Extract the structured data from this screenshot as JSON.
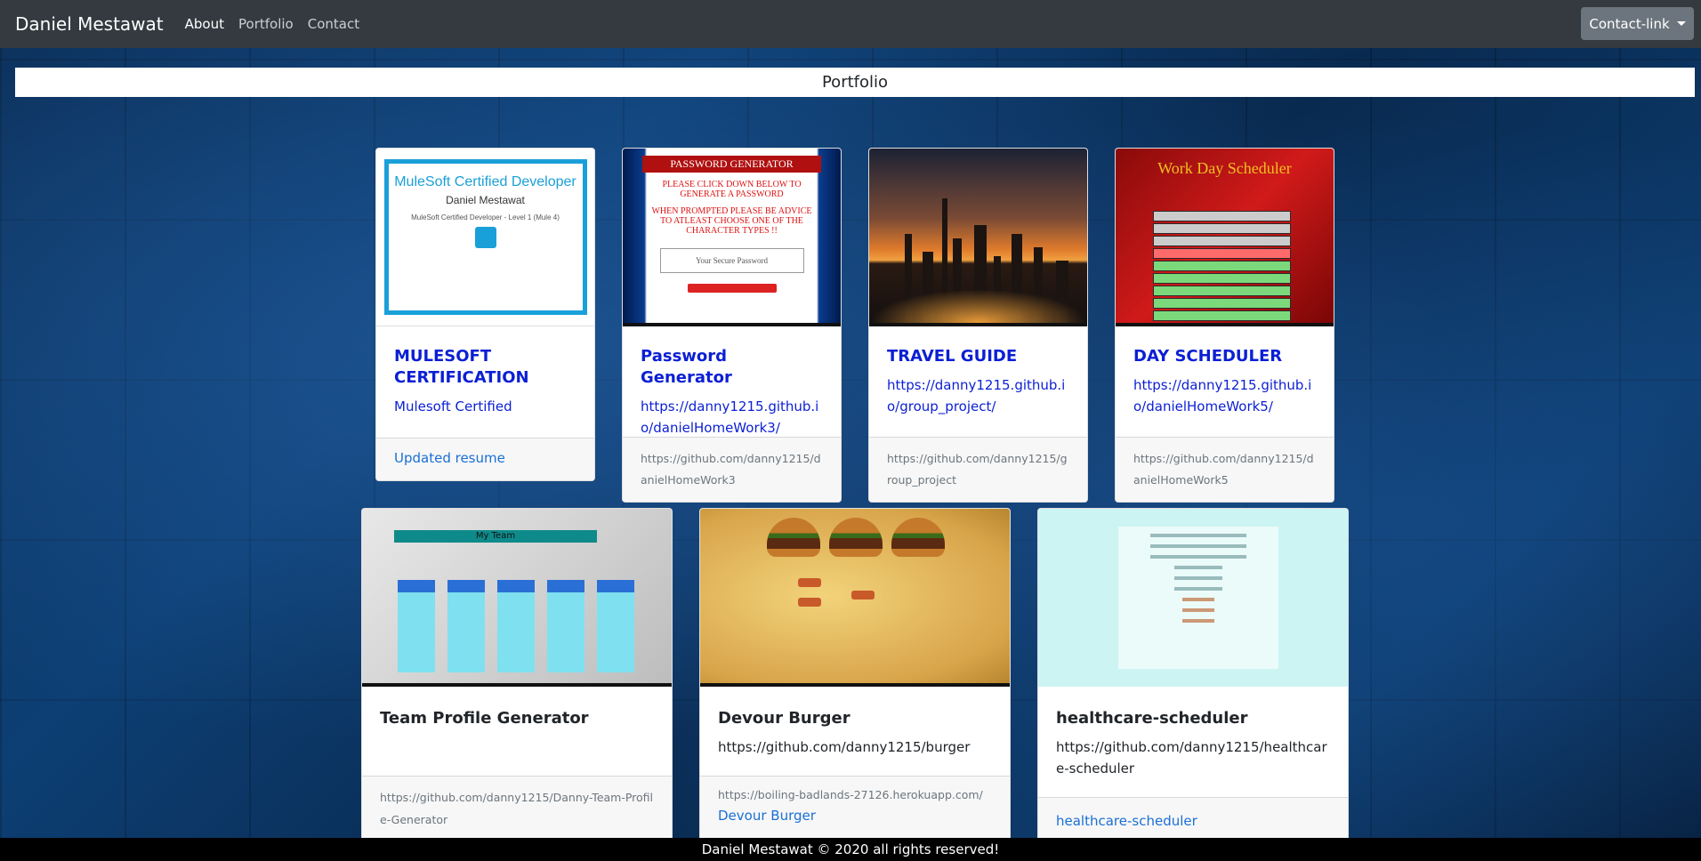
{
  "navbar": {
    "brand": "Daniel Mestawat",
    "links": [
      "About",
      "Portfolio",
      "Contact"
    ],
    "dropdown_label": "Contact-link"
  },
  "section_title": "Portfolio",
  "cards_row1": [
    {
      "thumbnail": "mulesoft-certificate",
      "thumb_text": {
        "title": "MuleSoft Certified Developer",
        "name": "Daniel Mestawat",
        "sub": "MuleSoft Certified Developer - Level 1 (Mule 4)"
      },
      "title": "MULESOFT CERTIFICATION",
      "link": "Mulesoft Certified",
      "footer": "Updated resume"
    },
    {
      "thumbnail": "password-generator",
      "thumb_text": {
        "header": "PASSWORD GENERATOR",
        "line1": "PLEASE CLICK DOWN BELOW TO GENERATE A PASSWORD",
        "line2": "WHEN PROMPTED PLEASE BE ADVICE TO ATLEAST CHOOSE ONE OF THE CHARACTER TYPES !!",
        "box": "Your Secure Password"
      },
      "title": "Password Generator",
      "link": "https://danny1215.github.io/danielHomeWork3/",
      "footer": "https://github.com/danny1215/danielHomeWork3"
    },
    {
      "thumbnail": "city-skyline",
      "title": "TRAVEL GUIDE",
      "link": "https://danny1215.github.io/group_project/",
      "footer": "https://github.com/danny1215/group_project"
    },
    {
      "thumbnail": "work-day-scheduler",
      "thumb_text": {
        "title": "Work Day Scheduler"
      },
      "title": "DAY SCHEDULER",
      "link": "https://danny1215.github.io/danielHomeWork5/",
      "footer": "https://github.com/danny1215/danielHomeWork5"
    }
  ],
  "cards_row2": [
    {
      "thumbnail": "team-profile",
      "thumb_text": {
        "header": "My Team"
      },
      "title": "Team Profile Generator",
      "text": "",
      "footer_text": "https://github.com/danny1215/Danny-Team-Profile-Generator",
      "footer_link": ""
    },
    {
      "thumbnail": "devour-burger",
      "title": "Devour Burger",
      "text": "https://github.com/danny1215/burger",
      "footer_text": "https://boiling-badlands-27126.herokuapp.com/",
      "footer_link": "Devour Burger"
    },
    {
      "thumbnail": "healthcare-form",
      "title": "healthcare-scheduler",
      "text": "https://github.com/danny1215/healthcare-scheduler",
      "footer_text": "",
      "footer_link": "healthcare-scheduler"
    }
  ],
  "footer": "Daniel Mestawat © 2020 all rights reserved!",
  "colors": {
    "navbar": "#343a40",
    "title_link": "#0b1fd4",
    "footer_link": "#1a6fd6",
    "page_footer": "#000000"
  }
}
